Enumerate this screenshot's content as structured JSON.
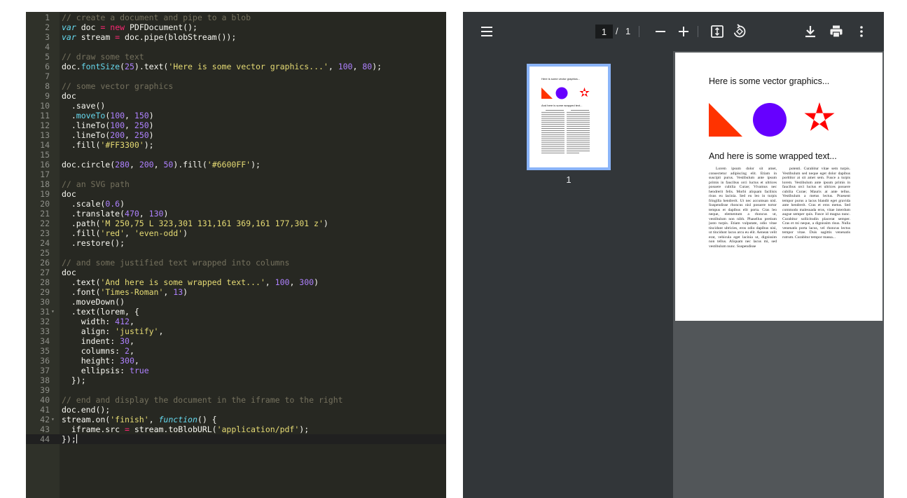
{
  "editor": {
    "lines": [
      {
        "n": "1",
        "tokens": [
          {
            "t": "// create a document and pipe to a blob",
            "c": "comment"
          }
        ]
      },
      {
        "n": "2",
        "tokens": [
          {
            "t": "var",
            "c": "keyword"
          },
          {
            "t": " doc ",
            "c": "plain"
          },
          {
            "t": "=",
            "c": "op"
          },
          {
            "t": " ",
            "c": "plain"
          },
          {
            "t": "new",
            "c": "op"
          },
          {
            "t": " PDFDocument();",
            "c": "plain"
          }
        ]
      },
      {
        "n": "3",
        "tokens": [
          {
            "t": "var",
            "c": "keyword"
          },
          {
            "t": " stream ",
            "c": "plain"
          },
          {
            "t": "=",
            "c": "op"
          },
          {
            "t": " doc.pipe(blobStream());",
            "c": "plain"
          }
        ]
      },
      {
        "n": "4",
        "tokens": []
      },
      {
        "n": "5",
        "tokens": [
          {
            "t": "// draw some text",
            "c": "comment"
          }
        ]
      },
      {
        "n": "6",
        "tokens": [
          {
            "t": "doc.",
            "c": "plain"
          },
          {
            "t": "fontSize",
            "c": "func"
          },
          {
            "t": "(",
            "c": "plain"
          },
          {
            "t": "25",
            "c": "num"
          },
          {
            "t": ").text(",
            "c": "plain"
          },
          {
            "t": "'Here is some vector graphics...'",
            "c": "str"
          },
          {
            "t": ", ",
            "c": "plain"
          },
          {
            "t": "100",
            "c": "num"
          },
          {
            "t": ", ",
            "c": "plain"
          },
          {
            "t": "80",
            "c": "num"
          },
          {
            "t": ");",
            "c": "plain"
          }
        ]
      },
      {
        "n": "7",
        "tokens": []
      },
      {
        "n": "8",
        "tokens": [
          {
            "t": "// some vector graphics",
            "c": "comment"
          }
        ]
      },
      {
        "n": "9",
        "tokens": [
          {
            "t": "doc",
            "c": "plain"
          }
        ]
      },
      {
        "n": "10",
        "tokens": [
          {
            "t": "  .save()",
            "c": "plain"
          }
        ]
      },
      {
        "n": "11",
        "tokens": [
          {
            "t": "  .",
            "c": "plain"
          },
          {
            "t": "moveTo",
            "c": "func"
          },
          {
            "t": "(",
            "c": "plain"
          },
          {
            "t": "100",
            "c": "num"
          },
          {
            "t": ", ",
            "c": "plain"
          },
          {
            "t": "150",
            "c": "num"
          },
          {
            "t": ")",
            "c": "plain"
          }
        ]
      },
      {
        "n": "12",
        "tokens": [
          {
            "t": "  .lineTo(",
            "c": "plain"
          },
          {
            "t": "100",
            "c": "num"
          },
          {
            "t": ", ",
            "c": "plain"
          },
          {
            "t": "250",
            "c": "num"
          },
          {
            "t": ")",
            "c": "plain"
          }
        ]
      },
      {
        "n": "13",
        "tokens": [
          {
            "t": "  .lineTo(",
            "c": "plain"
          },
          {
            "t": "200",
            "c": "num"
          },
          {
            "t": ", ",
            "c": "plain"
          },
          {
            "t": "250",
            "c": "num"
          },
          {
            "t": ")",
            "c": "plain"
          }
        ]
      },
      {
        "n": "14",
        "tokens": [
          {
            "t": "  .fill(",
            "c": "plain"
          },
          {
            "t": "'#FF3300'",
            "c": "str"
          },
          {
            "t": ");",
            "c": "plain"
          }
        ]
      },
      {
        "n": "15",
        "tokens": []
      },
      {
        "n": "16",
        "tokens": [
          {
            "t": "doc.circle(",
            "c": "plain"
          },
          {
            "t": "280",
            "c": "num"
          },
          {
            "t": ", ",
            "c": "plain"
          },
          {
            "t": "200",
            "c": "num"
          },
          {
            "t": ", ",
            "c": "plain"
          },
          {
            "t": "50",
            "c": "num"
          },
          {
            "t": ").fill(",
            "c": "plain"
          },
          {
            "t": "'#6600FF'",
            "c": "str"
          },
          {
            "t": ");",
            "c": "plain"
          }
        ]
      },
      {
        "n": "17",
        "tokens": []
      },
      {
        "n": "18",
        "tokens": [
          {
            "t": "// an SVG path",
            "c": "comment"
          }
        ]
      },
      {
        "n": "19",
        "tokens": [
          {
            "t": "doc",
            "c": "plain"
          }
        ]
      },
      {
        "n": "20",
        "tokens": [
          {
            "t": "  .scale(",
            "c": "plain"
          },
          {
            "t": "0.6",
            "c": "num"
          },
          {
            "t": ")",
            "c": "plain"
          }
        ]
      },
      {
        "n": "21",
        "tokens": [
          {
            "t": "  .translate(",
            "c": "plain"
          },
          {
            "t": "470",
            "c": "num"
          },
          {
            "t": ", ",
            "c": "plain"
          },
          {
            "t": "130",
            "c": "num"
          },
          {
            "t": ")",
            "c": "plain"
          }
        ]
      },
      {
        "n": "22",
        "tokens": [
          {
            "t": "  .path(",
            "c": "plain"
          },
          {
            "t": "'M 250,75 L 323,301 131,161 369,161 177,301 z'",
            "c": "str"
          },
          {
            "t": ")",
            "c": "plain"
          }
        ]
      },
      {
        "n": "23",
        "tokens": [
          {
            "t": "  .fill(",
            "c": "plain"
          },
          {
            "t": "'red'",
            "c": "str"
          },
          {
            "t": ", ",
            "c": "plain"
          },
          {
            "t": "'even-odd'",
            "c": "str"
          },
          {
            "t": ")",
            "c": "plain"
          }
        ]
      },
      {
        "n": "24",
        "tokens": [
          {
            "t": "  .restore();",
            "c": "plain"
          }
        ]
      },
      {
        "n": "25",
        "tokens": []
      },
      {
        "n": "26",
        "tokens": [
          {
            "t": "// and some justified text wrapped into columns",
            "c": "comment"
          }
        ]
      },
      {
        "n": "27",
        "tokens": [
          {
            "t": "doc",
            "c": "plain"
          }
        ]
      },
      {
        "n": "28",
        "tokens": [
          {
            "t": "  .text(",
            "c": "plain"
          },
          {
            "t": "'And here is some wrapped text...'",
            "c": "str"
          },
          {
            "t": ", ",
            "c": "plain"
          },
          {
            "t": "100",
            "c": "num"
          },
          {
            "t": ", ",
            "c": "plain"
          },
          {
            "t": "300",
            "c": "num"
          },
          {
            "t": ")",
            "c": "plain"
          }
        ]
      },
      {
        "n": "29",
        "tokens": [
          {
            "t": "  .font(",
            "c": "plain"
          },
          {
            "t": "'Times-Roman'",
            "c": "str"
          },
          {
            "t": ", ",
            "c": "plain"
          },
          {
            "t": "13",
            "c": "num"
          },
          {
            "t": ")",
            "c": "plain"
          }
        ]
      },
      {
        "n": "30",
        "tokens": [
          {
            "t": "  .moveDown()",
            "c": "plain"
          }
        ]
      },
      {
        "n": "31",
        "fold": true,
        "tokens": [
          {
            "t": "  .text(lorem, {",
            "c": "plain"
          }
        ]
      },
      {
        "n": "32",
        "tokens": [
          {
            "t": "    width: ",
            "c": "plain"
          },
          {
            "t": "412",
            "c": "num"
          },
          {
            "t": ",",
            "c": "plain"
          }
        ]
      },
      {
        "n": "33",
        "tokens": [
          {
            "t": "    align: ",
            "c": "plain"
          },
          {
            "t": "'justify'",
            "c": "str"
          },
          {
            "t": ",",
            "c": "plain"
          }
        ]
      },
      {
        "n": "34",
        "tokens": [
          {
            "t": "    indent: ",
            "c": "plain"
          },
          {
            "t": "30",
            "c": "num"
          },
          {
            "t": ",",
            "c": "plain"
          }
        ]
      },
      {
        "n": "35",
        "tokens": [
          {
            "t": "    columns: ",
            "c": "plain"
          },
          {
            "t": "2",
            "c": "num"
          },
          {
            "t": ",",
            "c": "plain"
          }
        ]
      },
      {
        "n": "36",
        "tokens": [
          {
            "t": "    height: ",
            "c": "plain"
          },
          {
            "t": "300",
            "c": "num"
          },
          {
            "t": ",",
            "c": "plain"
          }
        ]
      },
      {
        "n": "37",
        "tokens": [
          {
            "t": "    ellipsis: ",
            "c": "plain"
          },
          {
            "t": "true",
            "c": "num"
          }
        ]
      },
      {
        "n": "38",
        "tokens": [
          {
            "t": "  });",
            "c": "plain"
          }
        ]
      },
      {
        "n": "39",
        "tokens": []
      },
      {
        "n": "40",
        "tokens": [
          {
            "t": "// end and display the document in the iframe to the right",
            "c": "comment"
          }
        ]
      },
      {
        "n": "41",
        "tokens": [
          {
            "t": "doc.end();",
            "c": "plain"
          }
        ]
      },
      {
        "n": "42",
        "fold": true,
        "tokens": [
          {
            "t": "stream.on(",
            "c": "plain"
          },
          {
            "t": "'finish'",
            "c": "str"
          },
          {
            "t": ", ",
            "c": "plain"
          },
          {
            "t": "function",
            "c": "keyword"
          },
          {
            "t": "() {",
            "c": "plain"
          }
        ]
      },
      {
        "n": "43",
        "tokens": [
          {
            "t": "  iframe.src ",
            "c": "plain"
          },
          {
            "t": "=",
            "c": "op"
          },
          {
            "t": " stream.toBlobURL(",
            "c": "plain"
          },
          {
            "t": "'application/pdf'",
            "c": "str"
          },
          {
            "t": ");",
            "c": "plain"
          }
        ]
      },
      {
        "n": "44",
        "active": true,
        "cursor": true,
        "tokens": [
          {
            "t": "});",
            "c": "plain"
          }
        ]
      }
    ]
  },
  "viewer": {
    "toolbar": {
      "menu_icon": "menu-icon",
      "page_current": "1",
      "page_separator": "/",
      "page_total": "1",
      "zoom_out_icon": "minus-icon",
      "zoom_in_icon": "plus-icon",
      "fit_icon": "fit-to-page-icon",
      "rotate_icon": "rotate-icon",
      "download_icon": "download-icon",
      "print_icon": "print-icon",
      "more_icon": "more-vert-icon"
    },
    "thumbnail": {
      "number": "1",
      "frame_color": "#8ab4f8"
    },
    "page": {
      "heading1": "Here is some vector graphics...",
      "heading2": "And here is some wrapped text...",
      "triangle_color": "#FF3300",
      "circle_color": "#6600FF",
      "star_color": "#FF0000",
      "column1": "Lorem ipsum dolor sit amet, consectetur adipiscing elit. Etiam in suscipit purus. Vestibulum ante ipsum primis in faucibus orci luctus et ultrices posuere cubilia Curae; Vivamus nec hendrerit felis. Morbi aliquam facilisis risus eu lacinia. Sed eu leo in turpis fringilla hendrerit. Ut nec accumsan nisl. Suspendisse rhoncus nisl posuere tortor tempus et dapibus elit porta. Cras leo neque, elementum a rhoncus ut, vestibulum non nibh. Phasellus pretium justo turpis. Etiam vulputate, odio vitae tincidunt ultricies, eros odio dapibus nisi, ut tincidunt lacus arcu eu elit. Aenean velit erat, vehicula eget lacinia ut, dignissim non tellus. Aliquam nec lacus mi, sed vestibulum nunc. Suspendisse",
      "column2": "potenti. Curabitur vitae sem turpis. Vestibulum sed neque eget dolor dapibus porttitor at sit amet sem. Fusce a turpis lorem. Vestibulum ante ipsum primis in faucibus orci luctus et ultrices posuere cubilia Curae; Mauris at ante tellus. Vestibulum a metus lectus. Praesent tempor purus a lacus blandit eget gravida ante hendrerit. Cras et eros metus. Sed commodo malesuada eros, vitae interdum augue semper quis. Fusce id magna nunc. Curabitur sollicitudin placerat semper. Cras et mi neque, a dignissim risus. Nulla venenatis porta lacus, vel rhoncus lectus tempor vitae. Duis sagittis venenatis rutrum. Curabitur tempor massa..."
    }
  }
}
